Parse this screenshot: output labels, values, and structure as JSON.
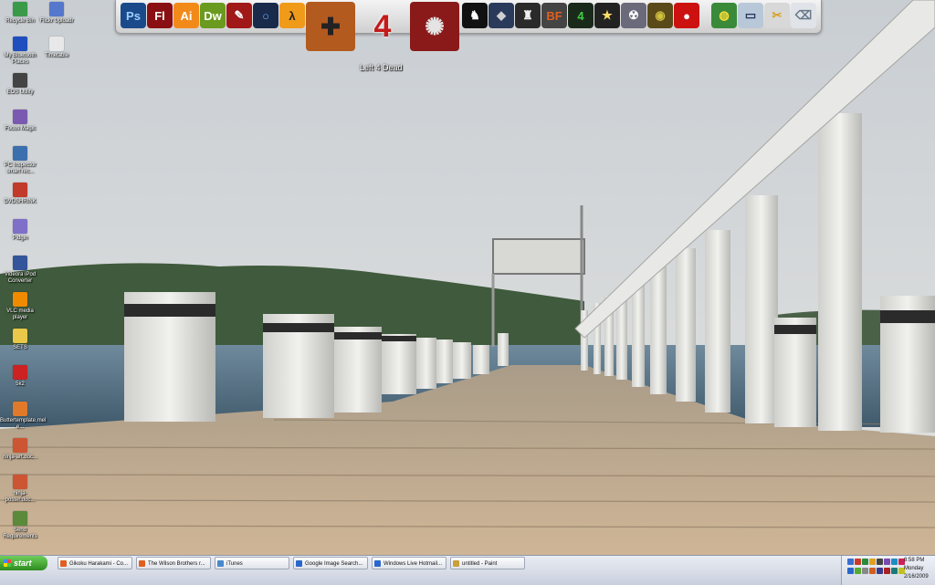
{
  "desktop": {
    "icons": [
      {
        "label": "Recycle Bin",
        "icon": "recycle-bin-icon",
        "color": "#3a9a4a"
      },
      {
        "label": "Flickr Uploadr",
        "icon": "flickr-icon",
        "color": "#5577cc"
      },
      {
        "label": "My Bluetooth Places",
        "icon": "bluetooth-icon",
        "color": "#1f4fbf"
      },
      {
        "label": "Timetable",
        "icon": "document-icon",
        "color": "#e8e8e8"
      },
      {
        "label": "EOS Utility",
        "icon": "camera-icon",
        "color": "#444444"
      },
      {
        "label": "Focus Magic",
        "icon": "focus-magic-icon",
        "color": "#7a5ab0"
      },
      {
        "label": "PC Inspector smart rec...",
        "icon": "pc-inspector-icon",
        "color": "#3c6fae"
      },
      {
        "label": "DVDSHRINK",
        "icon": "dvd-shrink-icon",
        "color": "#c23a2a"
      },
      {
        "label": "Pidgin",
        "icon": "pidgin-icon",
        "color": "#7f6fc8"
      },
      {
        "label": "Videora iPod Converter",
        "icon": "videora-icon",
        "color": "#335599"
      },
      {
        "label": "VLC media player",
        "icon": "vlc-icon",
        "color": "#f08a00"
      },
      {
        "label": "SETS",
        "icon": "folder-icon",
        "color": "#e9c84a"
      },
      {
        "label": "5k2",
        "icon": "pdf-icon",
        "color": "#cc2222"
      },
      {
        "label": "Buttertemplate.mel e...",
        "icon": "text-file-icon",
        "color": "#e07a2a"
      },
      {
        "label": "ninja-art.doc...",
        "icon": "word-doc-icon",
        "color": "#cc5533"
      },
      {
        "label": "ninja-poster.doc...",
        "icon": "word-doc-icon-2",
        "color": "#cc5533"
      },
      {
        "label": "Send Requirements",
        "icon": "notepad-icon",
        "color": "#5a8a3a"
      }
    ]
  },
  "dock": {
    "hover_label": "Left 4 Dead",
    "items": [
      {
        "name": "photoshop-icon",
        "text": "Ps",
        "bg": "#1b4a8a",
        "fg": "#9ad0ff"
      },
      {
        "name": "flash-icon",
        "text": "Fl",
        "bg": "#8a0f12",
        "fg": "#ffffff"
      },
      {
        "name": "illustrator-icon",
        "text": "Ai",
        "bg": "#f28a1a",
        "fg": "#ffffff"
      },
      {
        "name": "dreamweaver-icon",
        "text": "Dw",
        "bg": "#6a9a1e",
        "fg": "#ffffff"
      },
      {
        "name": "acrobat-icon",
        "text": "✎",
        "bg": "#a01818",
        "fg": "#ffffff"
      },
      {
        "name": "portal-icon",
        "text": "○",
        "bg": "#1a2a4a",
        "fg": "#6ab4ff"
      },
      {
        "name": "half-life-2-icon",
        "text": "λ",
        "bg": "#f09a1a",
        "fg": "#222222"
      },
      {
        "name": "team-fortress-2-icon",
        "text": "✚",
        "bg": "#b35a1f",
        "fg": "#222222"
      },
      {
        "name": "left-4-dead-icon",
        "text": "4",
        "bg": "#ffffff",
        "fg": "#c41a1a"
      },
      {
        "name": "spiral-game-icon",
        "text": "✺",
        "bg": "#8a1a1a",
        "fg": "#e4e4e4"
      },
      {
        "name": "assassin-icon",
        "text": "♞",
        "bg": "#111111",
        "fg": "#ffffff"
      },
      {
        "name": "mask-game-icon",
        "text": "◆",
        "bg": "#2a3a5a",
        "fg": "#d0d0d0"
      },
      {
        "name": "shield-game-icon",
        "text": "♜",
        "bg": "#2a2a2a",
        "fg": "#f0f0f0"
      },
      {
        "name": "battlefield-icon",
        "text": "BF",
        "bg": "#444444",
        "fg": "#e06020"
      },
      {
        "name": "call-of-duty-4-icon",
        "text": "4",
        "bg": "#1a2a1a",
        "fg": "#40d040"
      },
      {
        "name": "starcraft-2-icon",
        "text": "★",
        "bg": "#222222",
        "fg": "#ffdd66"
      },
      {
        "name": "robot-game-icon",
        "text": "☢",
        "bg": "#6a6a7a",
        "fg": "#ffffff"
      },
      {
        "name": "eye-game-icon",
        "text": "◉",
        "bg": "#5a4a1a",
        "fg": "#d0c040"
      },
      {
        "name": "fire-game-icon",
        "text": "●",
        "bg": "#cc1111",
        "fg": "#ffffff"
      },
      {
        "name": "globe-icon",
        "text": "◍",
        "bg": "#3a8a3a",
        "fg": "#ffdd33"
      },
      {
        "name": "my-computer-icon",
        "text": "▭",
        "bg": "#b8c8d8",
        "fg": "#223355"
      },
      {
        "name": "tools-icon",
        "text": "✂",
        "bg": "#d8d8d8",
        "fg": "#d8a020"
      },
      {
        "name": "trash-icon",
        "text": "⌫",
        "bg": "#e0e4e8",
        "fg": "#667788"
      }
    ]
  },
  "taskbar": {
    "start_label": "start",
    "tasks": [
      {
        "label": "Gikoku Harakami - Co...",
        "icon": "firefox-icon",
        "color": "#e06020"
      },
      {
        "label": "The Wilson Brothers r...",
        "icon": "firefox-icon",
        "color": "#e06020"
      },
      {
        "label": "iTunes",
        "icon": "itunes-icon",
        "color": "#4a88cc"
      },
      {
        "label": "Google Image Search...",
        "icon": "ie-icon",
        "color": "#2a66cc"
      },
      {
        "label": "Windows Live Hotmail...",
        "icon": "ie-icon",
        "color": "#2a66cc"
      },
      {
        "label": "untitled - Paint",
        "icon": "paint-icon",
        "color": "#c9a03a"
      }
    ],
    "tray": {
      "time": "8:58 PM",
      "day": "Monday",
      "date": "2/16/2009"
    }
  }
}
